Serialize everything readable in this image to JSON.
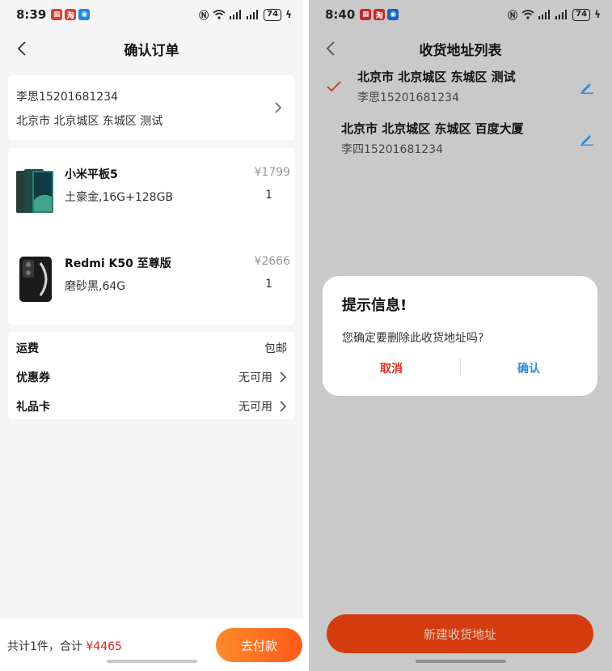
{
  "left": {
    "status": {
      "time": "8:39",
      "battery": "74"
    },
    "header": {
      "title": "确认订单"
    },
    "address": {
      "line1": "李思15201681234",
      "line2": "北京市 北京城区 东城区 测试"
    },
    "goods": [
      {
        "name": "小米平板5",
        "spec": "土豪金,16G+128GB",
        "price": "¥1799",
        "qty": "1"
      },
      {
        "name": "Redmi K50 至尊版",
        "spec": "磨砂黑,64G",
        "price": "¥2666",
        "qty": "1"
      }
    ],
    "fees": [
      {
        "label": "运费",
        "value": "包邮"
      },
      {
        "label": "优惠券",
        "value": "无可用"
      },
      {
        "label": "礼品卡",
        "value": "无可用"
      }
    ],
    "bottom": {
      "total_prefix": "共计1件，合计",
      "total_amount": "¥4465",
      "pay_label": "去付款"
    }
  },
  "right": {
    "status": {
      "time": "8:40",
      "battery": "74"
    },
    "header": {
      "title": "收货地址列表"
    },
    "addresses": [
      {
        "title": "北京市 北京城区 东城区 测试",
        "sub": "李思15201681234",
        "selected": true
      },
      {
        "title": "北京市 北京城区 东城区 百度大厦",
        "sub": "李四15201681234",
        "selected": false
      }
    ],
    "dialog": {
      "title": "提示信息!",
      "message": "您确定要删除此收货地址吗?",
      "cancel": "取消",
      "confirm": "确认"
    },
    "new_button": "新建收货地址"
  },
  "colors": {
    "accent": "#ff6a1e",
    "price_red": "#e02020",
    "link_blue": "#2f8bd8",
    "button_red": "#d43c10"
  },
  "icons": [
    "back-icon",
    "chevron-right-icon",
    "check-icon",
    "edit-icon",
    "wifi-icon",
    "signal-icon",
    "battery-icon",
    "nfc-icon"
  ]
}
